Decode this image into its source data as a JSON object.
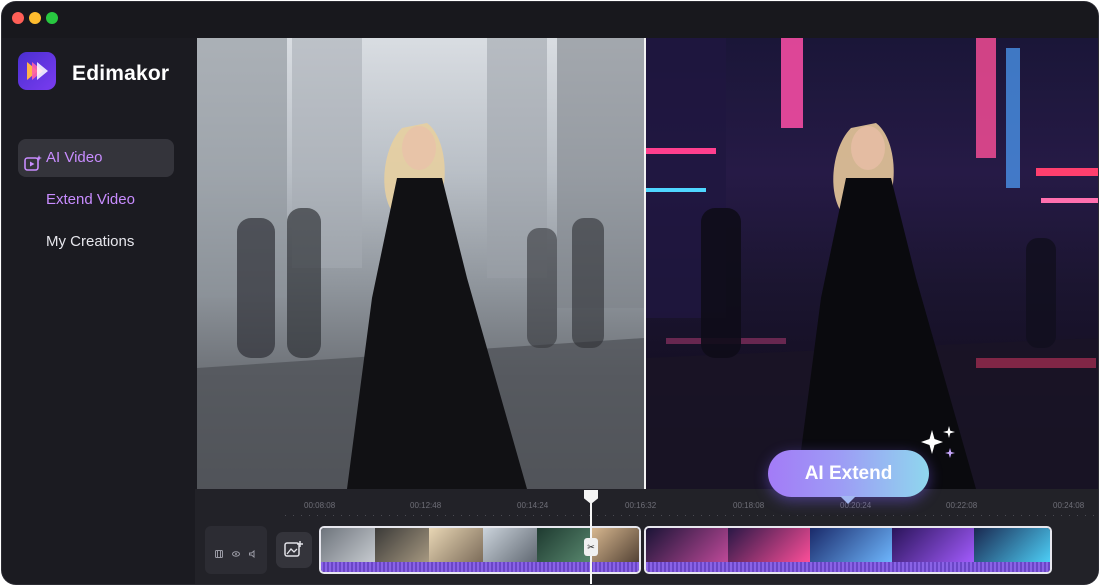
{
  "app": {
    "name": "Edimakor"
  },
  "sidebar": {
    "items": [
      {
        "label": "AI Video",
        "icon": "ai-video-icon",
        "active": true
      },
      {
        "label": "Extend Video",
        "icon": "",
        "active": false
      },
      {
        "label": "My Creations",
        "icon": "",
        "active": false
      }
    ]
  },
  "preview": {
    "extend_label": "AI Extend"
  },
  "timeline": {
    "ticks": [
      "00:08:08",
      "00:12:48",
      "00:14:24",
      "00:16:32",
      "00:18:08",
      "00:20:24",
      "00:22:08",
      "00:24:08"
    ]
  },
  "colors": {
    "accent": "#c88cff",
    "window_bg": "#1b1b21",
    "timeline_bg": "#222228",
    "extend_start": "#a37bf7",
    "extend_end": "#8fd7ee"
  }
}
